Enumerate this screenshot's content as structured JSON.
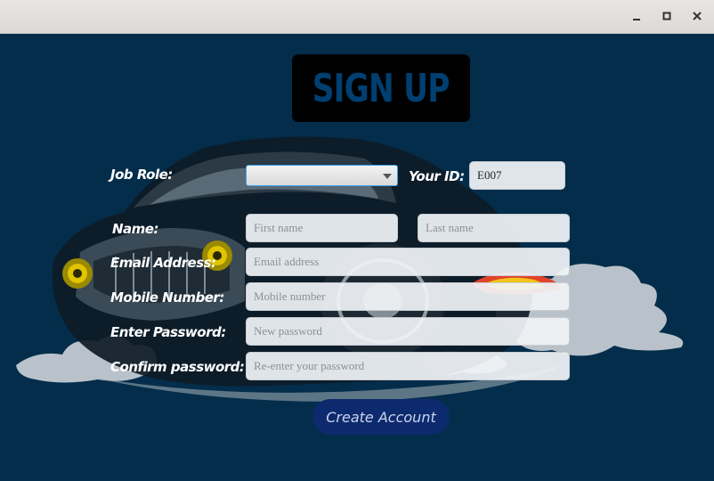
{
  "window": {
    "minimize_label": "Minimize",
    "maximize_label": "Maximize",
    "close_label": "Close"
  },
  "header": {
    "title": "SIGN UP"
  },
  "form": {
    "job_role_label": "Job Role:",
    "job_role_value": "",
    "your_id_label": "Your ID:",
    "your_id_value": "E007",
    "name_label": "Name:",
    "first_name_placeholder": "First name",
    "last_name_placeholder": "Last name",
    "email_label": "Email Address:",
    "email_placeholder": "Email address",
    "mobile_label": "Mobile Number:",
    "mobile_placeholder": "Mobile number",
    "password_label": "Enter Password:",
    "password_placeholder": "New password",
    "confirm_label": "Confirm password:",
    "confirm_placeholder": "Re-enter your password",
    "submit_label": "Create Account"
  },
  "colors": {
    "background": "#032d4b",
    "logo_bg": "#000000",
    "logo_text": "#003f70",
    "button_bg": "#0d2a6e",
    "focus_border": "#3aa0e6"
  }
}
